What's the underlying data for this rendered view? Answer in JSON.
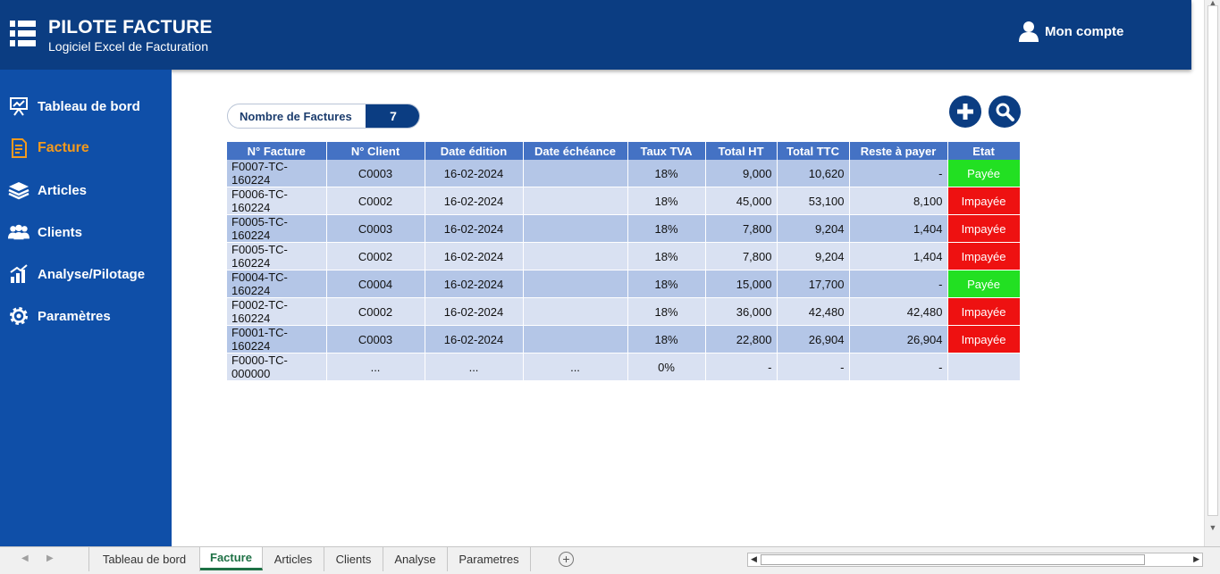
{
  "app": {
    "title": "PILOTE FACTURE",
    "subtitle": "Logiciel Excel de Facturation",
    "account_label": "Mon compte"
  },
  "sidebar": {
    "items": [
      {
        "label": "Tableau de bord",
        "icon": "presentation-board-icon",
        "active": false
      },
      {
        "label": "Facture",
        "icon": "invoice-icon",
        "active": true
      },
      {
        "label": "Articles",
        "icon": "stack-icon",
        "active": false
      },
      {
        "label": "Clients",
        "icon": "users-icon",
        "active": false
      },
      {
        "label": "Analyse/Pilotage",
        "icon": "bar-chart-icon",
        "active": false
      },
      {
        "label": "Paramètres",
        "icon": "gear-icon",
        "active": false
      }
    ]
  },
  "counter": {
    "label": "Nombre de Factures",
    "value": "7"
  },
  "table": {
    "headers": [
      "N° Facture",
      "N° Client",
      "Date édition",
      "Date échéance",
      "Taux TVA",
      "Total HT",
      "Total TTC",
      "Reste à payer",
      "Etat"
    ],
    "rows": [
      [
        "F0007-TC-160224",
        "C0003",
        "16-02-2024",
        "",
        "18%",
        "9,000",
        "10,620",
        "-",
        "Payée"
      ],
      [
        "F0006-TC-160224",
        "C0002",
        "16-02-2024",
        "",
        "18%",
        "45,000",
        "53,100",
        "8,100",
        "Impayée"
      ],
      [
        "F0005-TC-160224",
        "C0003",
        "16-02-2024",
        "",
        "18%",
        "7,800",
        "9,204",
        "1,404",
        "Impayée"
      ],
      [
        "F0005-TC-160224",
        "C0002",
        "16-02-2024",
        "",
        "18%",
        "7,800",
        "9,204",
        "1,404",
        "Impayée"
      ],
      [
        "F0004-TC-160224",
        "C0004",
        "16-02-2024",
        "",
        "18%",
        "15,000",
        "17,700",
        "-",
        "Payée"
      ],
      [
        "F0002-TC-160224",
        "C0002",
        "16-02-2024",
        "",
        "18%",
        "36,000",
        "42,480",
        "42,480",
        "Impayée"
      ],
      [
        "F0001-TC-160224",
        "C0003",
        "16-02-2024",
        "",
        "18%",
        "22,800",
        "26,904",
        "26,904",
        "Impayée"
      ],
      [
        "F0000-TC-000000",
        "...",
        "...",
        "...",
        "0%",
        "-",
        "-",
        "-",
        ""
      ]
    ]
  },
  "colors": {
    "header_bg": "#0b3d82",
    "sidebar_bg": "#0f4fa8",
    "active_nav": "#f39a1e",
    "paid": "#22e022",
    "unpaid": "#ee1111",
    "table_header": "#4472c4"
  },
  "sheet_tabs": [
    {
      "label": "Tableau de bord",
      "active": false
    },
    {
      "label": "Facture",
      "active": true
    },
    {
      "label": "Articles",
      "active": false
    },
    {
      "label": "Clients",
      "active": false
    },
    {
      "label": "Analyse",
      "active": false
    },
    {
      "label": "Parametres",
      "active": false
    }
  ]
}
